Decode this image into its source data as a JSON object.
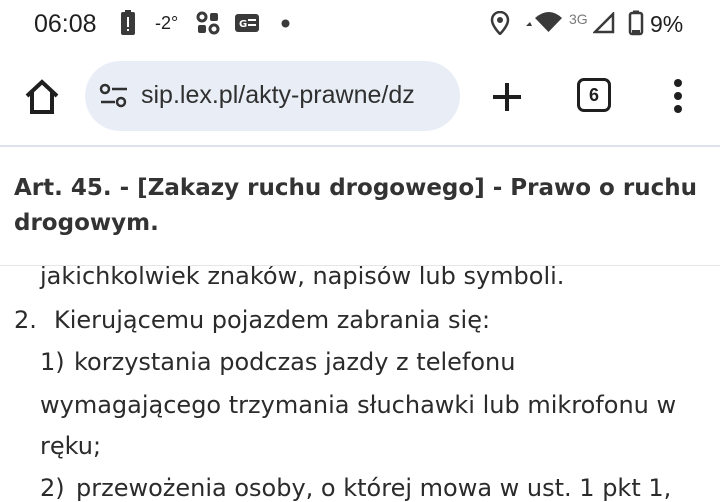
{
  "status_bar": {
    "time": "06:08",
    "temperature": "-2°",
    "battery_percent": "9%",
    "network": "3G",
    "icons": [
      "battery-alert-icon",
      "weather-icon",
      "apps-icon",
      "news-icon",
      "dot-icon",
      "location-icon",
      "wifi-icon",
      "signal-icon",
      "battery-icon"
    ]
  },
  "browser": {
    "url": "sip.lex.pl/akty-prawne/dz",
    "tab_count": "6",
    "icons": [
      "home-icon",
      "tune-icon",
      "plus-icon",
      "tabs-icon",
      "more-vert-icon"
    ]
  },
  "article": {
    "title": "Art. 45. - [Zakazy ruchu drogowego] - Prawo o ruchu drogowym.",
    "lines": [
      {
        "num": "",
        "text": "jakichkolwiek znaków, napisów lub symboli."
      },
      {
        "num": "2.",
        "text": "Kierującemu pojazdem zabrania się:"
      },
      {
        "num": "1)",
        "text": "korzystania podczas jazdy z telefonu"
      },
      {
        "num": "",
        "text": "wymagającego trzymania słuchawki lub mikrofonu w"
      },
      {
        "num": "",
        "text": "ręku;"
      },
      {
        "num": "2)",
        "text": "przewożenia osoby, o której mowa w ust. 1 pkt 1,"
      }
    ]
  },
  "colors": {
    "urlbar_bg": "#e9eef6",
    "text": "#2b2b2b",
    "divider": "#dde3ea"
  }
}
